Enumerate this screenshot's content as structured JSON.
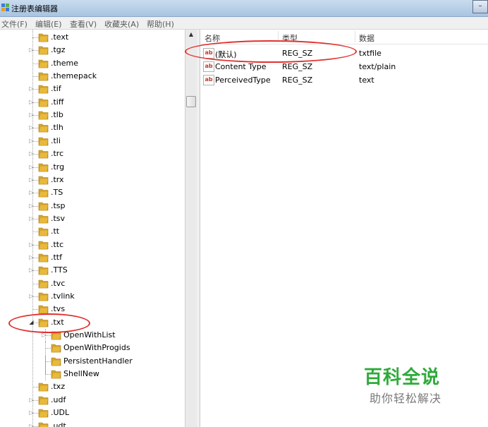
{
  "window": {
    "title": "注册表编辑器",
    "control": "–"
  },
  "menubar": [
    "文件(F)",
    "编辑(E)",
    "查看(V)",
    "收藏夹(A)",
    "帮助(H)"
  ],
  "tree": {
    "items": [
      {
        "label": ".text",
        "expandable": false
      },
      {
        "label": ".tgz",
        "expandable": true
      },
      {
        "label": ".theme",
        "expandable": false
      },
      {
        "label": ".themepack",
        "expandable": false
      },
      {
        "label": ".tif",
        "expandable": true
      },
      {
        "label": ".tiff",
        "expandable": true
      },
      {
        "label": ".tlb",
        "expandable": true
      },
      {
        "label": ".tlh",
        "expandable": true
      },
      {
        "label": ".tli",
        "expandable": true
      },
      {
        "label": ".trc",
        "expandable": true
      },
      {
        "label": ".trg",
        "expandable": true
      },
      {
        "label": ".trx",
        "expandable": true
      },
      {
        "label": ".TS",
        "expandable": true
      },
      {
        "label": ".tsp",
        "expandable": true
      },
      {
        "label": ".tsv",
        "expandable": true
      },
      {
        "label": ".tt",
        "expandable": false
      },
      {
        "label": ".ttc",
        "expandable": true
      },
      {
        "label": ".ttf",
        "expandable": true
      },
      {
        "label": ".TTS",
        "expandable": true
      },
      {
        "label": ".tvc",
        "expandable": false
      },
      {
        "label": ".tvlink",
        "expandable": true
      },
      {
        "label": ".tvs",
        "expandable": false
      },
      {
        "label": ".txt",
        "expandable": true,
        "expanded": true
      },
      {
        "label": "OpenWithList",
        "expandable": true,
        "child": true
      },
      {
        "label": "OpenWithProgids",
        "expandable": false,
        "child": true
      },
      {
        "label": "PersistentHandler",
        "expandable": false,
        "child": true
      },
      {
        "label": "ShellNew",
        "expandable": false,
        "child": true
      },
      {
        "label": ".txz",
        "expandable": false
      },
      {
        "label": ".udf",
        "expandable": true
      },
      {
        "label": ".UDL",
        "expandable": true
      },
      {
        "label": ".udt",
        "expandable": true
      }
    ]
  },
  "list": {
    "columns": [
      "名称",
      "类型",
      "数据"
    ],
    "rows": [
      {
        "name": "(默认)",
        "type": "REG_SZ",
        "data": "txtfile"
      },
      {
        "name": "Content Type",
        "type": "REG_SZ",
        "data": "text/plain"
      },
      {
        "name": "PerceivedType",
        "type": "REG_SZ",
        "data": "text"
      }
    ]
  },
  "watermark": {
    "title": "百科全说",
    "subtitle": "助你轻松解决"
  },
  "colors": {
    "annotation": "#e0312e",
    "watermark": "#2eaa3a",
    "folder": "#e8b93a"
  }
}
